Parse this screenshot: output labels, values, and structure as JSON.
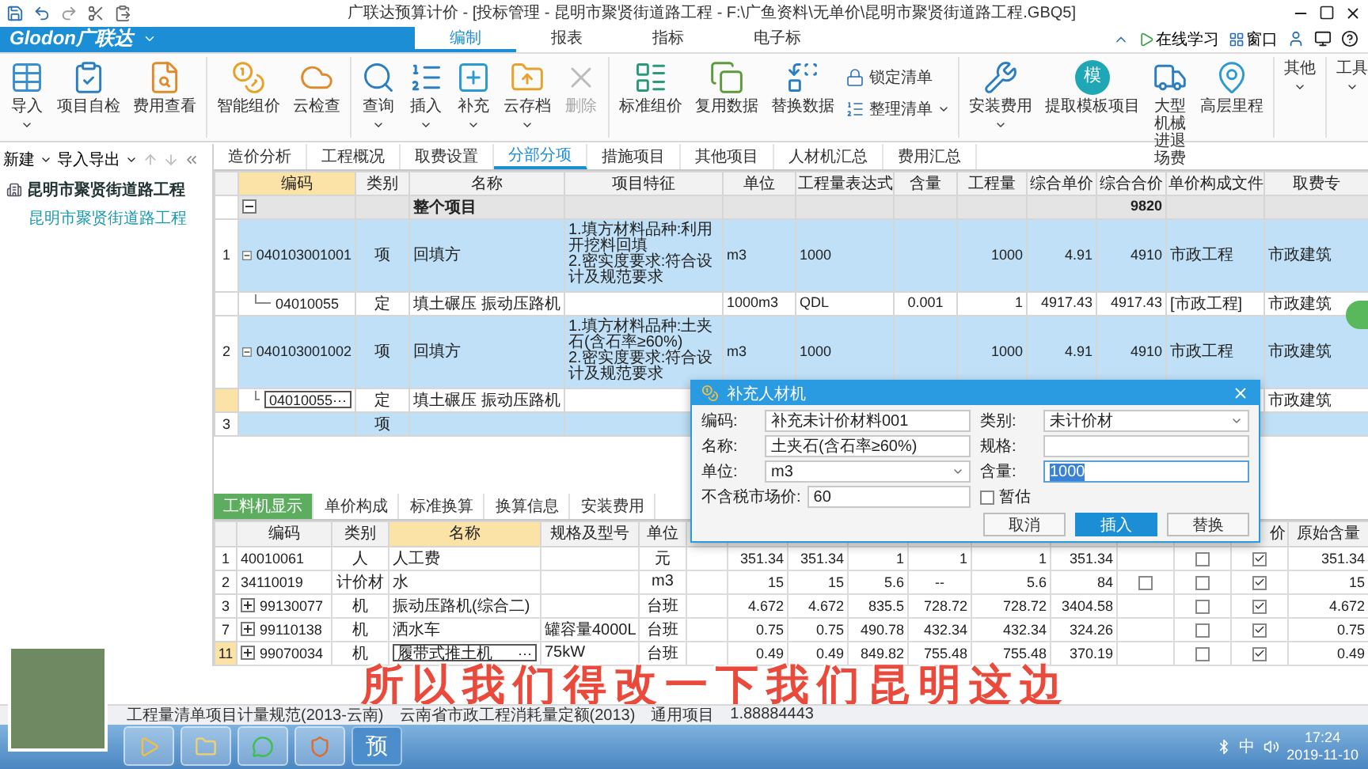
{
  "title_bar": {
    "title": "广联达预算计价 - [投标管理 - 昆明市聚贤街道路工程 - F:\\广鱼资料\\无单价\\昆明市聚贤街道路工程.GBQ5]"
  },
  "menu_bar": {
    "logo": "Glodon广联达",
    "tabs": [
      {
        "label": "编制",
        "selected": true
      },
      {
        "label": "报表",
        "selected": false
      },
      {
        "label": "指标",
        "selected": false
      },
      {
        "label": "电子标",
        "selected": false
      }
    ],
    "online_help": "在线学习",
    "window_menu": "窗口"
  },
  "ribbon": [
    {
      "items": [
        {
          "label": "导入",
          "kind": "large",
          "dropdown": true,
          "disabled": false
        },
        {
          "label": "项目自检",
          "kind": "large",
          "dropdown": false,
          "disabled": false
        },
        {
          "label": "费用查看",
          "kind": "large",
          "dropdown": false,
          "disabled": false
        }
      ]
    },
    {
      "items": [
        {
          "label": "智能组价",
          "kind": "large",
          "dropdown": false,
          "disabled": false
        },
        {
          "label": "云检查",
          "kind": "large",
          "dropdown": false,
          "disabled": false
        }
      ]
    },
    {
      "items": [
        {
          "label": "查询",
          "kind": "large",
          "dropdown": true,
          "disabled": false
        },
        {
          "label": "插入",
          "kind": "large",
          "dropdown": true,
          "disabled": false
        },
        {
          "label": "补充",
          "kind": "large",
          "dropdown": true,
          "disabled": false
        },
        {
          "label": "云存档",
          "kind": "large",
          "dropdown": true,
          "disabled": false
        },
        {
          "label": "删除",
          "kind": "large",
          "dropdown": false,
          "disabled": true
        }
      ]
    },
    {
      "items": [
        {
          "label": "标准组价",
          "kind": "large",
          "dropdown": false,
          "disabled": false
        },
        {
          "label": "复用数据",
          "kind": "large",
          "dropdown": false,
          "disabled": false
        },
        {
          "label": "替换数据",
          "kind": "large",
          "dropdown": false,
          "disabled": false
        },
        {
          "label": "锁定清单",
          "kind": "small",
          "dropdown": false,
          "disabled": false
        },
        {
          "label": "整理清单",
          "kind": "small",
          "dropdown": true,
          "disabled": false
        }
      ]
    },
    {
      "items": [
        {
          "label": "安装费用",
          "kind": "large",
          "dropdown": true,
          "disabled": false
        },
        {
          "label": "提取模板项目",
          "kind": "large",
          "dropdown": false,
          "disabled": false,
          "icon_text": "模"
        },
        {
          "label": "大型机械进退场费",
          "kind": "large",
          "dropdown": false,
          "disabled": false
        },
        {
          "label": "高层里程",
          "kind": "large",
          "dropdown": false,
          "disabled": false
        }
      ]
    },
    {
      "items": [
        {
          "label": "其他",
          "kind": "large",
          "dropdown": true,
          "disabled": false
        }
      ]
    },
    {
      "items": [
        {
          "label": "工具",
          "kind": "large",
          "dropdown": true,
          "disabled": false
        }
      ]
    }
  ],
  "left_toolbar": {
    "new": "新建",
    "import_export": "导入导出"
  },
  "tree": [
    {
      "label": "昆明市聚贤街道路工程",
      "selected": false,
      "children": [
        {
          "label": "昆明市聚贤街道路工程",
          "selected": true
        }
      ]
    }
  ],
  "main_tabs": [
    {
      "label": "造价分析",
      "selected": false
    },
    {
      "label": "工程概况",
      "selected": false
    },
    {
      "label": "取费设置",
      "selected": false
    },
    {
      "label": "分部分项",
      "selected": true
    },
    {
      "label": "措施项目",
      "selected": false
    },
    {
      "label": "其他项目",
      "selected": false
    },
    {
      "label": "人材机汇总",
      "selected": false
    },
    {
      "label": "费用汇总",
      "selected": false
    }
  ],
  "main_table": {
    "columns": [
      {
        "label": "编码",
        "selected": true
      },
      {
        "label": "类别",
        "selected": false
      },
      {
        "label": "名称",
        "selected": false
      },
      {
        "label": "项目特征",
        "selected": false
      },
      {
        "label": "单位",
        "selected": false
      },
      {
        "label": "工程量表达式",
        "selected": false
      },
      {
        "label": "含量",
        "selected": false
      },
      {
        "label": "工程量",
        "selected": false
      },
      {
        "label": "综合单价",
        "selected": false
      },
      {
        "label": "综合合价",
        "selected": false
      },
      {
        "label": "单价构成文件",
        "selected": false
      },
      {
        "label": "取费专",
        "selected": false
      }
    ],
    "rows": [
      {
        "kind": "group",
        "name": "整个项目",
        "total": "9820",
        "expanded": true,
        "selected": false
      },
      {
        "kind": "item",
        "num": "1",
        "code": "040103001001",
        "type": "项",
        "name": "回填方",
        "features": [
          "1.填方材料品种:利用开挖料回填",
          "2.密实度要求:符合设计及规范要求"
        ],
        "unit": "m3",
        "expr": "1000",
        "qty": "1000",
        "price": "4.91",
        "total": "4910",
        "file": "市政工程",
        "fee": "市政建筑",
        "expanded": true,
        "selected": false
      },
      {
        "kind": "quota",
        "code": "04010055",
        "type": "定",
        "name": "填土碾压 振动压路机",
        "unit": "1000m3",
        "expr": "QDL",
        "content": "0.001",
        "qty": "1",
        "price": "4917.43",
        "total": "4917.43",
        "file": "[市政工程]",
        "fee": "市政建筑",
        "expanded": false,
        "selected": false
      },
      {
        "kind": "item",
        "num": "2",
        "code": "040103001002",
        "type": "项",
        "name": "回填方",
        "features": [
          "1.填方材料品种:土夹石(含石率≥60%)",
          "2.密实度要求:符合设计及规范要求"
        ],
        "unit": "m3",
        "expr": "1000",
        "qty": "1000",
        "price": "4.91",
        "total": "4910",
        "file": "市政工程",
        "fee": "市政建筑",
        "expanded": true,
        "selected": false
      },
      {
        "kind": "quota",
        "code": "04010055",
        "type": "定",
        "name": "填土碾压 振动压路机",
        "fee": "市政建筑",
        "edit_button": "···",
        "expanded": false,
        "selected": true
      },
      {
        "kind": "item",
        "num": "3",
        "type": "项",
        "expanded": false,
        "selected": false
      }
    ]
  },
  "lower_tabs": [
    {
      "label": "工料机显示",
      "selected": true
    },
    {
      "label": "单价构成",
      "selected": false
    },
    {
      "label": "标准换算",
      "selected": false
    },
    {
      "label": "换算信息",
      "selected": false
    },
    {
      "label": "安装费用",
      "selected": false
    }
  ],
  "lower_table": {
    "header_left": [
      {
        "label": "编码",
        "selected": false
      },
      {
        "label": "类别",
        "selected": false
      },
      {
        "label": "名称",
        "selected": true
      },
      {
        "label": "规格及型号",
        "selected": false
      },
      {
        "label": "单位",
        "selected": false
      }
    ],
    "header_right": [
      {
        "label": "价",
        "selected": false
      },
      {
        "label": "原始含量",
        "selected": false
      }
    ],
    "rows": [
      {
        "num": "1",
        "code": "40010061",
        "type": "人",
        "name": "人工费",
        "unit": "元",
        "values": [
          "351.34",
          "351.34",
          "1",
          "1",
          "1",
          "351.34"
        ],
        "check_2": false,
        "check_3": true,
        "original": "351.34",
        "collapsed": false,
        "selected": false
      },
      {
        "num": "2",
        "code": "34110019",
        "type": "计价材",
        "name": "水",
        "unit": "m3",
        "values": [
          "15",
          "15",
          "5.6",
          "--",
          "5.6",
          "84"
        ],
        "check_1": false,
        "check_2": false,
        "check_3": true,
        "original": "15",
        "collapsed": false,
        "selected": false
      },
      {
        "num": "3",
        "code": "99130077",
        "type": "机",
        "name": "振动压路机(综合二)",
        "unit": "台班",
        "values": [
          "4.672",
          "4.672",
          "835.5",
          "728.72",
          "728.72",
          "3404.58"
        ],
        "check_2": false,
        "check_3": true,
        "original": "4.672",
        "collapsed": true,
        "selected": false
      },
      {
        "num": "7",
        "code": "99110138",
        "type": "机",
        "name": "洒水车",
        "spec": "罐容量4000L",
        "unit": "台班",
        "values": [
          "0.75",
          "0.75",
          "490.78",
          "432.34",
          "432.34",
          "324.26"
        ],
        "check_2": false,
        "check_3": true,
        "original": "0.75",
        "collapsed": true,
        "selected": false
      },
      {
        "num": "11",
        "code": "99070034",
        "type": "机",
        "name": "履带式推土机",
        "spec": "75kW",
        "unit": "台班",
        "values": [
          "0.49",
          "0.49",
          "849.82",
          "755.48",
          "755.48",
          "370.19"
        ],
        "check_2": false,
        "check_3": true,
        "original": "0.49",
        "collapsed": true,
        "selected": true,
        "edit_button": "···"
      }
    ]
  },
  "dialog": {
    "title": "补充人材机",
    "fields": [
      {
        "label": "编码:",
        "value": "补充未计价材料001",
        "kind": "text",
        "highlighted": false
      },
      {
        "label": "类别:",
        "value": "未计价材",
        "kind": "select",
        "highlighted": false
      },
      {
        "label": "名称:",
        "value": "土夹石(含石率≥60%)",
        "kind": "text",
        "highlighted": false
      },
      {
        "label": "规格:",
        "kind": "text",
        "highlighted": false
      },
      {
        "label": "单位:",
        "value": "m3",
        "kind": "select",
        "highlighted": false
      },
      {
        "label": "含量:",
        "value": "1000",
        "kind": "text",
        "highlighted": true
      },
      {
        "label": "不含税市场价:",
        "value": "60",
        "kind": "text",
        "highlighted": false
      }
    ],
    "estimate": {
      "label": "暂估",
      "checked": false
    },
    "buttons": [
      {
        "label": "取消",
        "primary": false
      },
      {
        "label": "插入",
        "primary": true
      },
      {
        "label": "替换",
        "primary": false
      }
    ]
  },
  "caption": "所以我们得改一下我们昆明这边",
  "status_bar": [
    "工程量清单项目计量规范(2013-云南)",
    "云南省市政工程消耗量定额(2013)",
    "通用项目",
    "1.88884443"
  ],
  "taskbar": {
    "apps": [
      {
        "kind": "media"
      },
      {
        "kind": "folder"
      },
      {
        "kind": "chat"
      },
      {
        "kind": "game"
      },
      {
        "kind": "text",
        "label": "预"
      }
    ],
    "ime": "中",
    "time": "17:24",
    "date": "2019-11-10"
  }
}
